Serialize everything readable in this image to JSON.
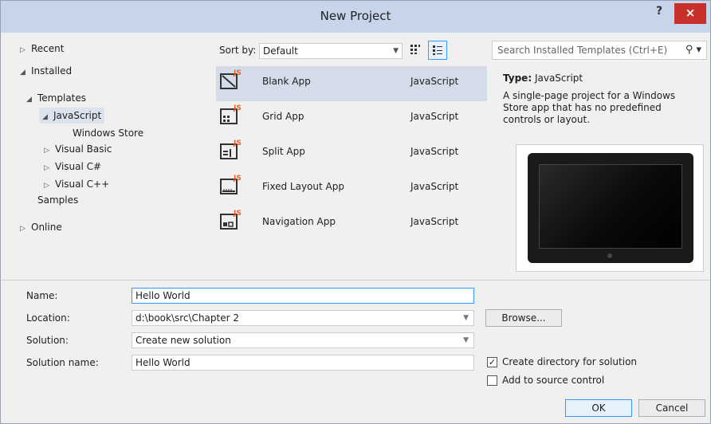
{
  "window": {
    "title": "New Project",
    "help_label": "?",
    "close_label": "×"
  },
  "tree": {
    "recent": "Recent",
    "installed": "Installed",
    "templates": "Templates",
    "javascript": "JavaScript",
    "windows_store": "Windows Store",
    "visual_basic": "Visual Basic",
    "visual_csharp": "Visual C#",
    "visual_cpp": "Visual C++",
    "samples": "Samples",
    "online": "Online"
  },
  "toolbar": {
    "sort_label": "Sort by:",
    "sort_value": "Default"
  },
  "templates": [
    {
      "name": "Blank App",
      "language": "JavaScript"
    },
    {
      "name": "Grid App",
      "language": "JavaScript"
    },
    {
      "name": "Split App",
      "language": "JavaScript"
    },
    {
      "name": "Fixed Layout App",
      "language": "JavaScript"
    },
    {
      "name": "Navigation App",
      "language": "JavaScript"
    }
  ],
  "search": {
    "placeholder": "Search Installed Templates (Ctrl+E)"
  },
  "details": {
    "type_label": "Type:",
    "type_value": "JavaScript",
    "description": "A single-page project for a Windows Store app that has no predefined controls or layout."
  },
  "form": {
    "name_label": "Name:",
    "name_value": "Hello World",
    "location_label": "Location:",
    "location_value": "d:\\book\\src\\Chapter 2",
    "solution_label": "Solution:",
    "solution_value": "Create new solution",
    "solution_name_label": "Solution name:",
    "solution_name_value": "Hello World",
    "browse_label": "Browse...",
    "create_dir_label": "Create directory for solution",
    "source_control_label": "Add to source control",
    "ok_label": "OK",
    "cancel_label": "Cancel",
    "create_dir_checked": true,
    "source_control_checked": false
  },
  "colors": {
    "titlebar": "#c6d5ea",
    "close_button": "#c9302c",
    "selection": "#d4dcea",
    "accent": "#3399ff",
    "js_badge": "#e8632b"
  }
}
